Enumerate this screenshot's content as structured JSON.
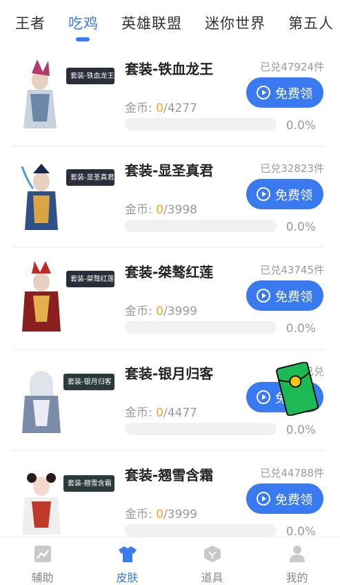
{
  "tabs": [
    {
      "label": "王者"
    },
    {
      "label": "吃鸡"
    },
    {
      "label": "英雄联盟"
    },
    {
      "label": "迷你世界"
    },
    {
      "label": "第五人"
    }
  ],
  "active_tab": "吃鸡",
  "coin_label": "金币: ",
  "claim_label": "免费领",
  "items": [
    {
      "title": "套装-铁血龙王",
      "redeemed": "已兑47924件",
      "current": "0",
      "total": "/4277",
      "progress_pct": 0,
      "percent": "0.0%",
      "banner": "套装-铁血龙王"
    },
    {
      "title": "套装-显圣真君",
      "redeemed": "已兑32823件",
      "current": "0",
      "total": "/3998",
      "progress_pct": 0,
      "percent": "0.0%",
      "banner": "套装-显圣真君"
    },
    {
      "title": "套装-桀骜红莲",
      "redeemed": "已兑43745件",
      "current": "0",
      "total": "/3999",
      "progress_pct": 0,
      "percent": "0.0%",
      "banner": "套装-桀骜红莲"
    },
    {
      "title": "套装-银月归客",
      "redeemed": "已兑",
      "current": "0",
      "total": "/4477",
      "progress_pct": 0,
      "percent": "0.0%",
      "banner": "套装-银月归客"
    },
    {
      "title": "套装-翘雪含霜",
      "redeemed": "已兑44788件",
      "current": "0",
      "total": "/3999",
      "progress_pct": 0,
      "percent": "0.0%",
      "banner": "套装-翘雪含霜"
    }
  ],
  "bottom_nav": [
    {
      "label": "辅助",
      "icon": "chart-icon"
    },
    {
      "label": "皮肤",
      "icon": "shirt-icon"
    },
    {
      "label": "道具",
      "icon": "box-icon"
    },
    {
      "label": "我的",
      "icon": "user-icon"
    }
  ],
  "colors": {
    "accent": "#3a7af0",
    "coin": "#f5a623",
    "envelope": "#1db954"
  }
}
